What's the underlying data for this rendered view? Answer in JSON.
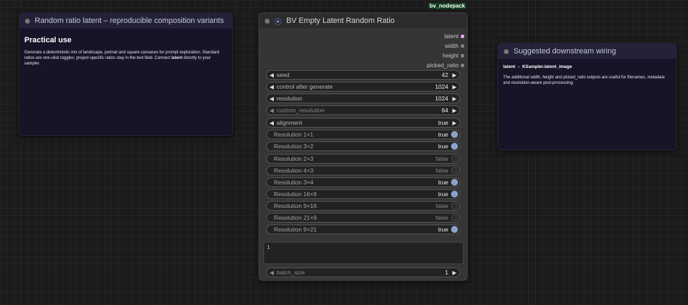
{
  "group_tag": "bv_nodepack",
  "note_left": {
    "title": "Random ratio latent – reproducible composition variants",
    "heading": "Practical use",
    "text_1": "Generate a deterministic mix of landscape, portrait and square canvases for prompt exploration. Standard ratios are one-click toggles; project-specific ratios stay in the text field. Connect ",
    "text_bold": "latent",
    "text_2": " directly to your sampler."
  },
  "note_right": {
    "title": "Suggested downstream wiring",
    "wiring": "latent → KSampler.latent_image",
    "text": "The additional width, height and picked_ratio outputs are useful for filenames, metadata and resolution-aware post-processing."
  },
  "node": {
    "title": "BV Empty Latent Random Ratio",
    "icon": "swirl-icon",
    "outputs": [
      "latent",
      "width",
      "height",
      "picked_ratio"
    ],
    "widgets": {
      "seed": {
        "label": "seed",
        "value": "42"
      },
      "control": {
        "label": "control after generate",
        "value": "1024"
      },
      "resolution": {
        "label": "resolution",
        "value": "1024"
      },
      "custom_resolution": {
        "label": "custom_resolution",
        "value": "64"
      },
      "alignment": {
        "label": "alignment",
        "value": "true"
      },
      "batch_size": {
        "label": "batch_size",
        "value": "1"
      }
    },
    "toggles": [
      {
        "label": "Resolution 1×1",
        "value": "true"
      },
      {
        "label": "Resolution 3×2",
        "value": "true"
      },
      {
        "label": "Resolution 2×3",
        "value": "false"
      },
      {
        "label": "Resolution 4×3",
        "value": "false"
      },
      {
        "label": "Resolution 3×4",
        "value": "true"
      },
      {
        "label": "Resolution 16×9",
        "value": "true"
      },
      {
        "label": "Resolution 9×16",
        "value": "false"
      },
      {
        "label": "Resolution 21×9",
        "value": "false"
      },
      {
        "label": "Resolution 9×21",
        "value": "true"
      }
    ],
    "custom_ratios_text": "1"
  },
  "colors": {
    "accent": "#6d8dff",
    "toggle_on": "#8da2c7",
    "latent_socket": "#ff9cf9"
  }
}
